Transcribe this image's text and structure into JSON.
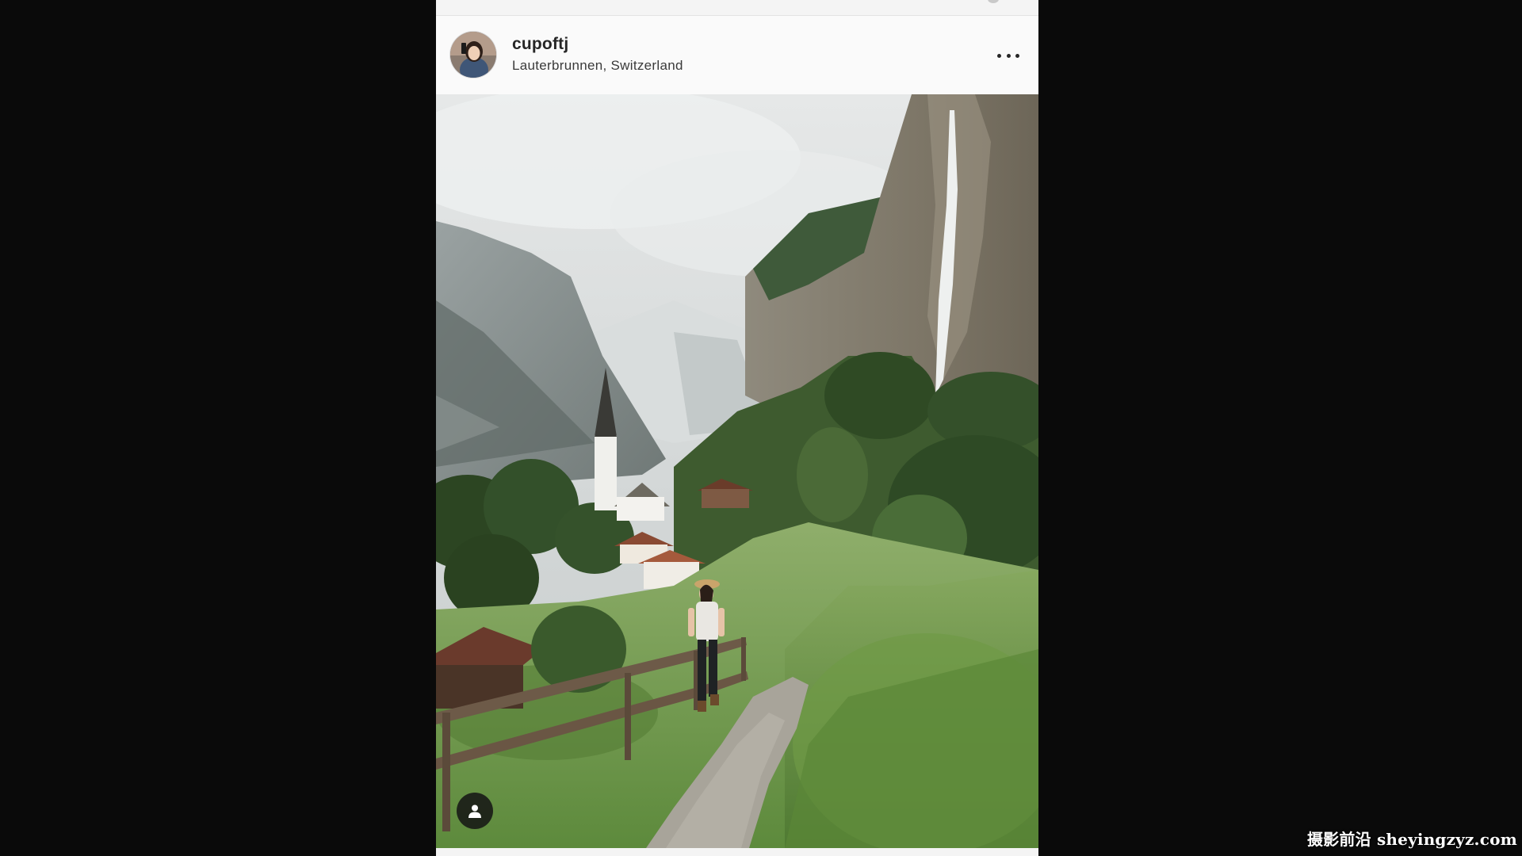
{
  "post": {
    "username": "cupoftj",
    "location": "Lauterbrunnen, Switzerland",
    "more_icon": "more-horizontal-icon",
    "tag_icon": "user-tag-icon"
  },
  "watermark": {
    "text": "摄影前沿 sheyingzyz.com"
  },
  "colors": {
    "page_background": "#0a0a0a",
    "card_background": "#fafafa",
    "text_primary": "#262626"
  }
}
